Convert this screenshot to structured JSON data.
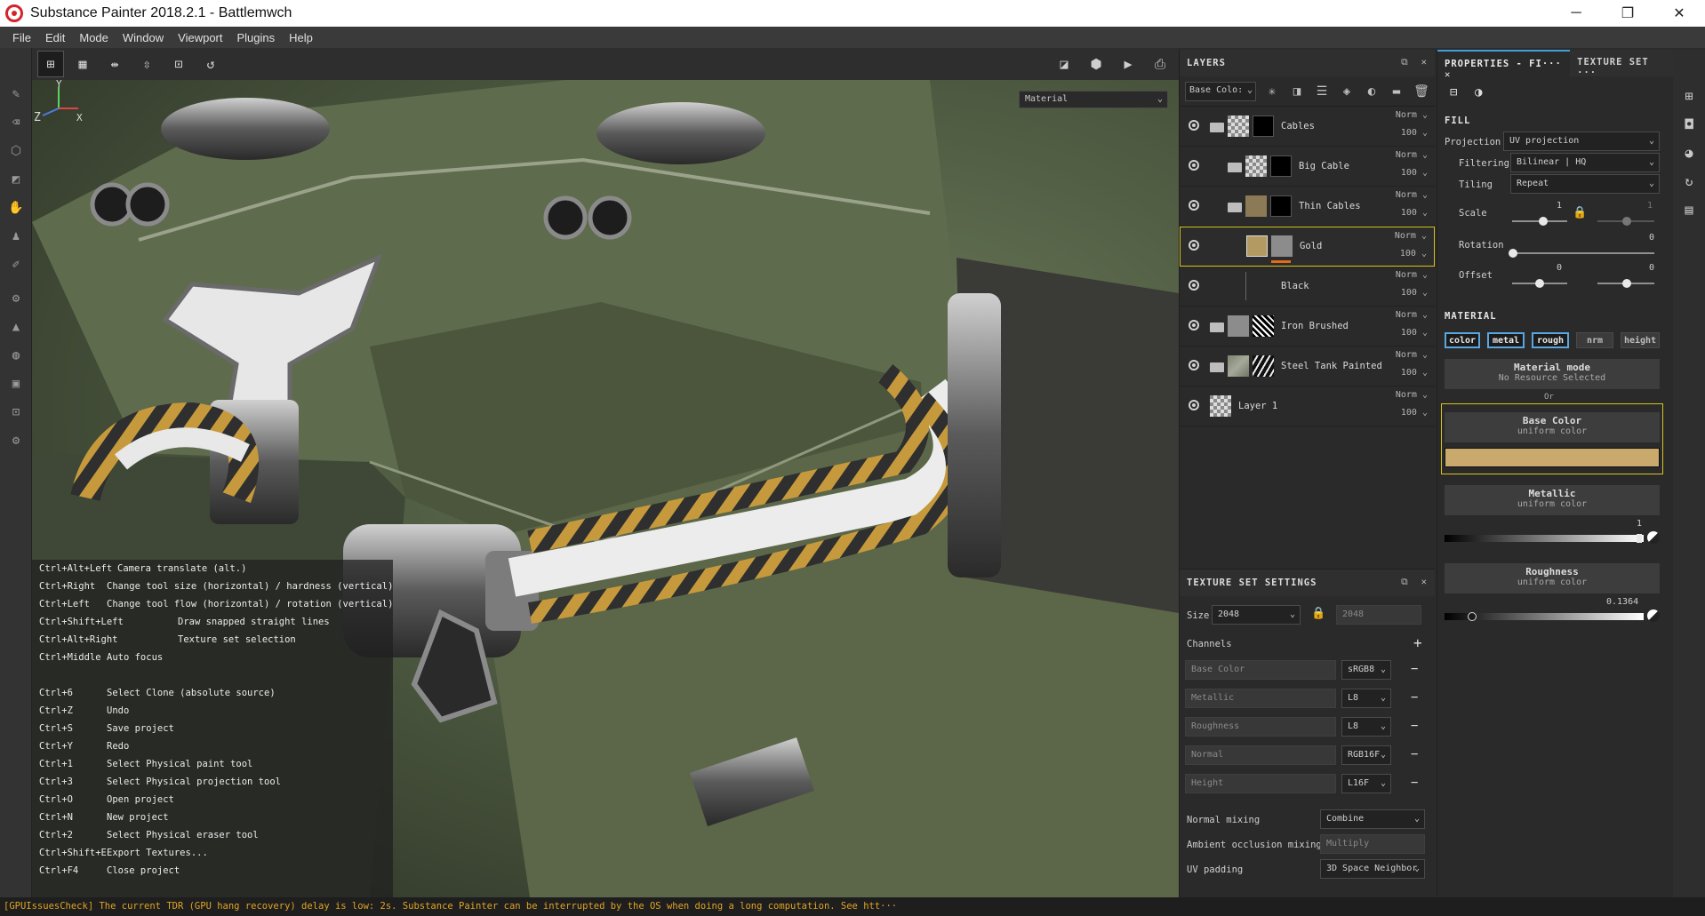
{
  "window": {
    "title": "Substance Painter 2018.2.1 - Battlemwch",
    "minimize": "─",
    "restore": "❐",
    "close": "✕"
  },
  "menu": [
    "File",
    "Edit",
    "Mode",
    "Window",
    "Viewport",
    "Plugins",
    "Help"
  ],
  "viewport": {
    "material_select": "Material",
    "axis": {
      "y": "Y",
      "z": "Z",
      "x": "X"
    },
    "shortcuts": [
      {
        "key": "Ctrl+Alt+Left",
        "desc": "Camera translate (alt.)"
      },
      {
        "key": "Ctrl+Right",
        "desc": "Change tool size (horizontal) / hardness (vertical)"
      },
      {
        "key": "Ctrl+Left",
        "desc": "Change tool flow (horizontal) / rotation (vertical)"
      },
      {
        "key": "Ctrl+Shift+Left",
        "desc": "Draw snapped straight lines"
      },
      {
        "key": "Ctrl+Alt+Right",
        "desc": "Texture set selection"
      },
      {
        "key": "Ctrl+Middle",
        "desc": "Auto focus"
      },
      {
        "key": "Ctrl+6",
        "desc": "Select Clone (absolute source)"
      },
      {
        "key": "Ctrl+Z",
        "desc": "Undo"
      },
      {
        "key": "Ctrl+S",
        "desc": "Save project"
      },
      {
        "key": "Ctrl+Y",
        "desc": "Redo"
      },
      {
        "key": "Ctrl+1",
        "desc": "Select Physical paint tool"
      },
      {
        "key": "Ctrl+3",
        "desc": "Select Physical projection tool"
      },
      {
        "key": "Ctrl+O",
        "desc": "Open project"
      },
      {
        "key": "Ctrl+N",
        "desc": "New project"
      },
      {
        "key": "Ctrl+2",
        "desc": "Select Physical eraser tool"
      },
      {
        "key": "Ctrl+Shift+E",
        "desc": "Export Textures..."
      },
      {
        "key": "Ctrl+F4",
        "desc": "Close project"
      }
    ]
  },
  "layers": {
    "title": "LAYERS",
    "channel_select": "Base Colo:",
    "items": [
      {
        "name": "Cables",
        "blend": "Norm",
        "opacity": "100"
      },
      {
        "name": "Big Cable",
        "blend": "Norm",
        "opacity": "100"
      },
      {
        "name": "Thin Cables",
        "blend": "Norm",
        "opacity": "100"
      },
      {
        "name": "Gold",
        "blend": "Norm",
        "opacity": "100"
      },
      {
        "name": "Black",
        "blend": "Norm",
        "opacity": "100"
      },
      {
        "name": "Iron Brushed",
        "blend": "Norm",
        "opacity": "100"
      },
      {
        "name": "Steel Tank Painted",
        "blend": "Norm",
        "opacity": "100"
      },
      {
        "name": "Layer 1",
        "blend": "Norm",
        "opacity": "100"
      }
    ]
  },
  "texture_set": {
    "title": "TEXTURE SET SETTINGS",
    "size_label": "Size",
    "size_value": "2048",
    "size_value2": "2048",
    "channels_label": "Channels",
    "channels": [
      {
        "name": "Base Color",
        "format": "sRGB8"
      },
      {
        "name": "Metallic",
        "format": "L8"
      },
      {
        "name": "Roughness",
        "format": "L8"
      },
      {
        "name": "Normal",
        "format": "RGB16F"
      },
      {
        "name": "Height",
        "format": "L16F"
      }
    ],
    "normal_mixing_label": "Normal mixing",
    "normal_mixing_value": "Combine",
    "ao_mixing_label": "Ambient occlusion mixing",
    "ao_mixing_value": "Multiply",
    "uv_padding_label": "UV padding",
    "uv_padding_value": "3D Space Neighbor"
  },
  "properties": {
    "tab_active": "PROPERTIES - FI···",
    "tab_other": "TEXTURE SET ···",
    "fill_title": "FILL",
    "projection_label": "Projection",
    "projection_value": "UV projection",
    "filtering_label": "Filtering",
    "filtering_value": "Bilinear | HQ",
    "tiling_label": "Tiling",
    "tiling_value": "Repeat",
    "scale_label": "Scale",
    "scale_value": "1",
    "scale_value2": "1",
    "rotation_label": "Rotation",
    "rotation_value": "0",
    "offset_label": "Offset",
    "offset_value1": "0",
    "offset_value2": "0",
    "material_title": "MATERIAL",
    "channel_buttons": [
      "color",
      "metal",
      "rough",
      "nrm",
      "height"
    ],
    "material_mode_title": "Material mode",
    "material_mode_sub": "No Resource Selected",
    "or_label": "Or",
    "base_color_title": "Base Color",
    "base_color_sub": "uniform color",
    "base_color_hex": "#c9aa6c",
    "metallic_title": "Metallic",
    "metallic_sub": "uniform color",
    "metallic_value": "1",
    "roughness_title": "Roughness",
    "roughness_sub": "uniform color",
    "roughness_value": "0.1364"
  },
  "status": "[GPUIssuesCheck] The current TDR (GPU hang recovery) delay is low: 2s. Substance Painter can be interrupted by the OS when doing a long computation. See htt···"
}
